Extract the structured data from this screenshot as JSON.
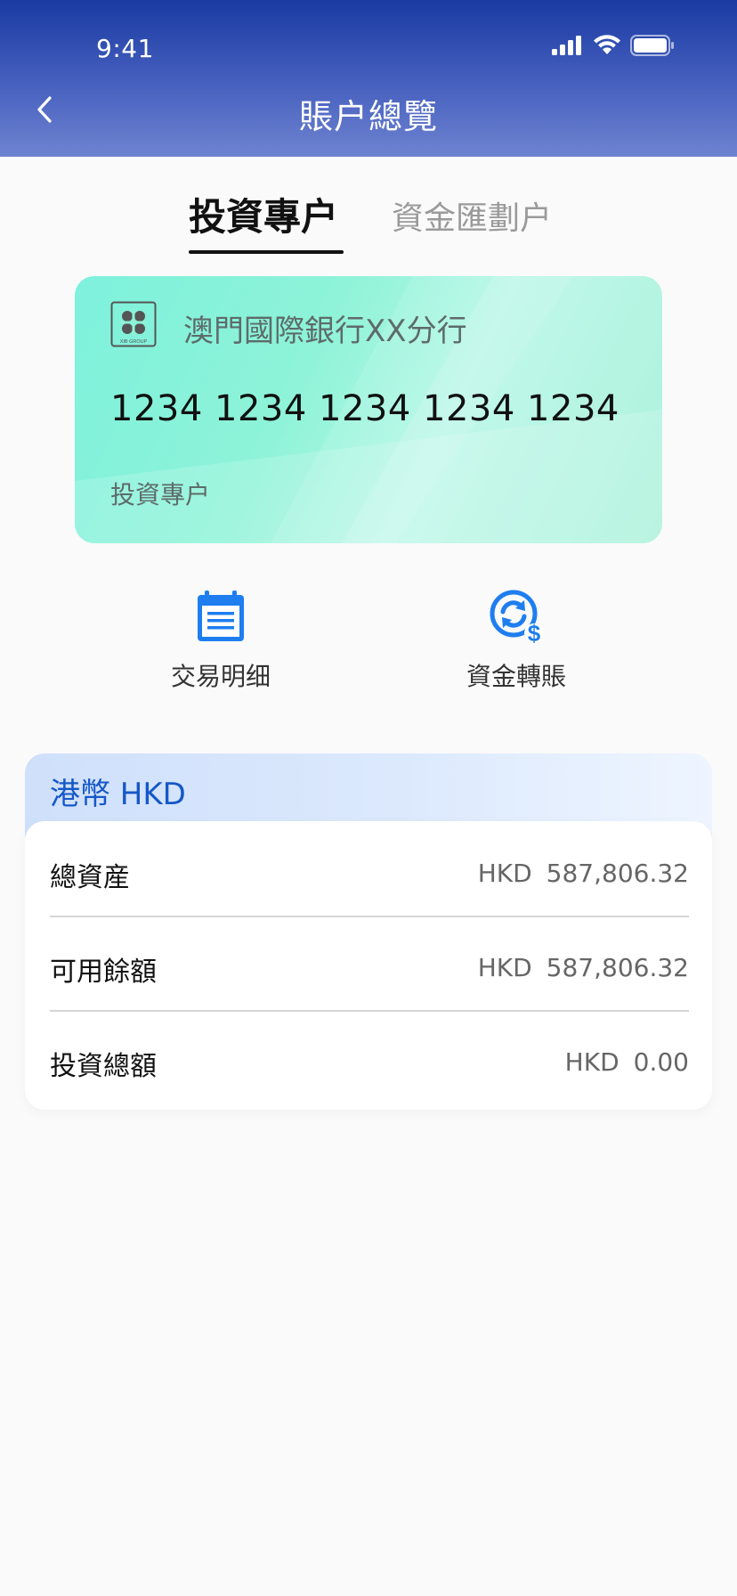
{
  "status_bar": {
    "time": "9:41"
  },
  "header": {
    "title": "賬户總覽"
  },
  "tabs": [
    {
      "label": "投資專户",
      "active": true
    },
    {
      "label": "資金匯劃户",
      "active": false
    }
  ],
  "account_card": {
    "bank_name": "澳門國際銀行XX分行",
    "logo_text": "XIB GROUP",
    "card_number": "1234 1234 1234 1234 1234",
    "account_type": "投資專户"
  },
  "actions": [
    {
      "label": "交易明细",
      "icon": "calendar-list-icon"
    },
    {
      "label": "資金轉賬",
      "icon": "refresh-dollar-icon"
    }
  ],
  "balance": {
    "currency_title": "港幣 HKD",
    "rows": [
      {
        "label": "總資産",
        "currency": "HKD",
        "amount": "587,806.32"
      },
      {
        "label": "可用餘額",
        "currency": "HKD",
        "amount": "587,806.32"
      },
      {
        "label": "投資總額",
        "currency": "HKD",
        "amount": "0.00"
      }
    ]
  },
  "colors": {
    "header_top": "#1a3aa2",
    "header_bottom": "#6e83d0",
    "card_green": "#8ef3d8",
    "accent_blue": "#1e7ef0",
    "currency_blue": "#1558c8"
  }
}
